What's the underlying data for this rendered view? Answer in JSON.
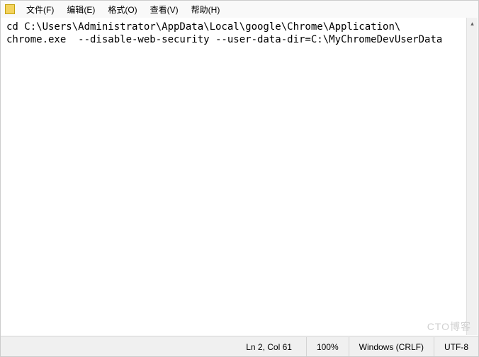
{
  "menubar": {
    "items": [
      {
        "label": "文件(F)"
      },
      {
        "label": "编辑(E)"
      },
      {
        "label": "格式(O)"
      },
      {
        "label": "查看(V)"
      },
      {
        "label": "帮助(H)"
      }
    ]
  },
  "content": {
    "line1": "cd C:\\Users\\Administrator\\AppData\\Local\\google\\Chrome\\Application\\",
    "line2": "chrome.exe  --disable-web-security --user-data-dir=C:\\MyChromeDevUserData"
  },
  "statusbar": {
    "position": "Ln 2,  Col 61",
    "zoom": "100%",
    "line_ending": "Windows (CRLF)",
    "encoding": "UTF-8"
  },
  "watermark": "CTO博客"
}
